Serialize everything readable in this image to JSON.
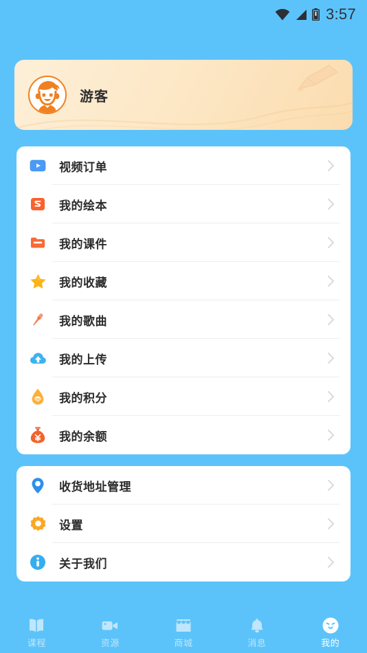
{
  "statusbar": {
    "time": "3:57",
    "icons": [
      "wifi-icon",
      "signal-icon",
      "battery-icon"
    ]
  },
  "profile": {
    "name": "游客",
    "avatar_icon": "user-avatar-boy",
    "watermark_icon": "pencil-watermark"
  },
  "menu_cards": [
    {
      "items": [
        {
          "label": "视频订单",
          "icon": "video-play-icon",
          "color": "#3C8FF5"
        },
        {
          "label": "我的绘本",
          "icon": "picture-book-s-icon",
          "color": "#F9622C"
        },
        {
          "label": "我的课件",
          "icon": "folder-icon",
          "color": "#F96A33"
        },
        {
          "label": "我的收藏",
          "icon": "star-icon",
          "color": "#FCB316"
        },
        {
          "label": "我的歌曲",
          "icon": "microphone-icon",
          "color": "#F5774A"
        },
        {
          "label": "我的上传",
          "icon": "cloud-upload-icon",
          "color": "#35AEEF"
        },
        {
          "label": "我的积分",
          "icon": "points-drop-icon",
          "color": "#FBB03B"
        },
        {
          "label": "我的余额",
          "icon": "money-bag-icon",
          "color": "#F4622C"
        }
      ]
    },
    {
      "items": [
        {
          "label": "收货地址管理",
          "icon": "location-pin-icon",
          "color": "#2F8FEB"
        },
        {
          "label": "设置",
          "icon": "gear-icon",
          "color": "#F9A825"
        },
        {
          "label": "关于我们",
          "icon": "info-icon",
          "color": "#35AEEF"
        }
      ]
    }
  ],
  "tabbar": {
    "items": [
      {
        "label": "课程",
        "icon": "book-icon",
        "active": false
      },
      {
        "label": "资源",
        "icon": "video-camera-icon",
        "active": false
      },
      {
        "label": "商城",
        "icon": "store-icon",
        "active": false
      },
      {
        "label": "消息",
        "icon": "bell-icon",
        "active": false
      },
      {
        "label": "我的",
        "icon": "smiley-face-icon",
        "active": true
      }
    ]
  },
  "colors": {
    "background": "#5CC3FA",
    "card": "#FFFFFF",
    "divider": "#EDEDED",
    "text": "#2c2c2c",
    "chevron": "#D8D8D8",
    "tab_inactive": "#BFE6FB",
    "tab_active": "#FFFFFF"
  }
}
